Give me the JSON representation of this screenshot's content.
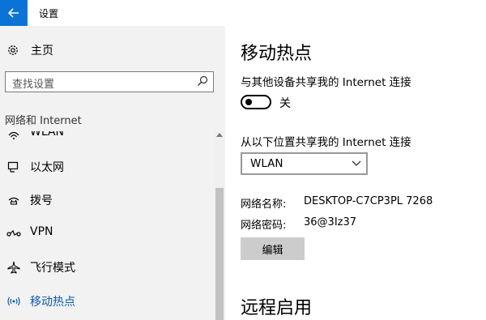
{
  "window": {
    "title": "设置"
  },
  "sidebar": {
    "home_label": "主页",
    "search_placeholder": "查找设置",
    "section_title": "网络和 Internet",
    "items": [
      {
        "label": "WLAN",
        "icon": "wifi-icon"
      },
      {
        "label": "以太网",
        "icon": "ethernet-icon"
      },
      {
        "label": "拨号",
        "icon": "dialup-icon"
      },
      {
        "label": "VPN",
        "icon": "vpn-icon"
      },
      {
        "label": "飞行模式",
        "icon": "airplane-icon"
      },
      {
        "label": "移动热点",
        "icon": "hotspot-icon",
        "selected": true
      }
    ]
  },
  "main": {
    "title": "移动热点",
    "share_label": "与其他设备共享我的 Internet 连接",
    "toggle_state": "关",
    "toggle_on": false,
    "share_from_label": "从以下位置共享我的 Internet 连接",
    "share_from_value": "WLAN",
    "network_name_label": "网络名称:",
    "network_name": "DESKTOP-C7CP3PL 7268",
    "password_label": "网络密码:",
    "password": "36@3Iz37",
    "edit_label": "编辑",
    "remote_title": "远程启用"
  },
  "colors": {
    "accent": "#0a73d6",
    "selected_text": "#0a58b4",
    "sidebar_bg": "#f2f2f2"
  }
}
